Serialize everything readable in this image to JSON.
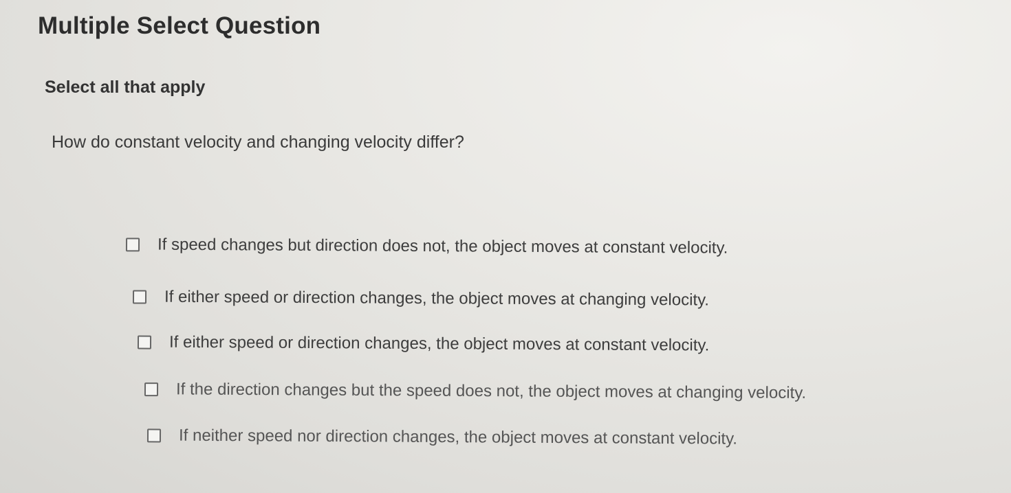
{
  "question": {
    "type_heading": "Multiple Select Question",
    "instruction": "Select all that apply",
    "prompt": "How do constant velocity and changing velocity differ?"
  },
  "options": [
    {
      "label": "If speed changes but direction does not, the object moves at constant velocity.",
      "checked": false
    },
    {
      "label": "If either speed or direction changes, the object moves at changing velocity.",
      "checked": false
    },
    {
      "label": "If either speed or direction changes, the object moves at constant velocity.",
      "checked": false
    },
    {
      "label": "If the direction changes but the speed does not, the object moves at changing velocity.",
      "checked": false
    },
    {
      "label": "If neither speed nor direction changes, the object moves at constant velocity.",
      "checked": false
    }
  ]
}
